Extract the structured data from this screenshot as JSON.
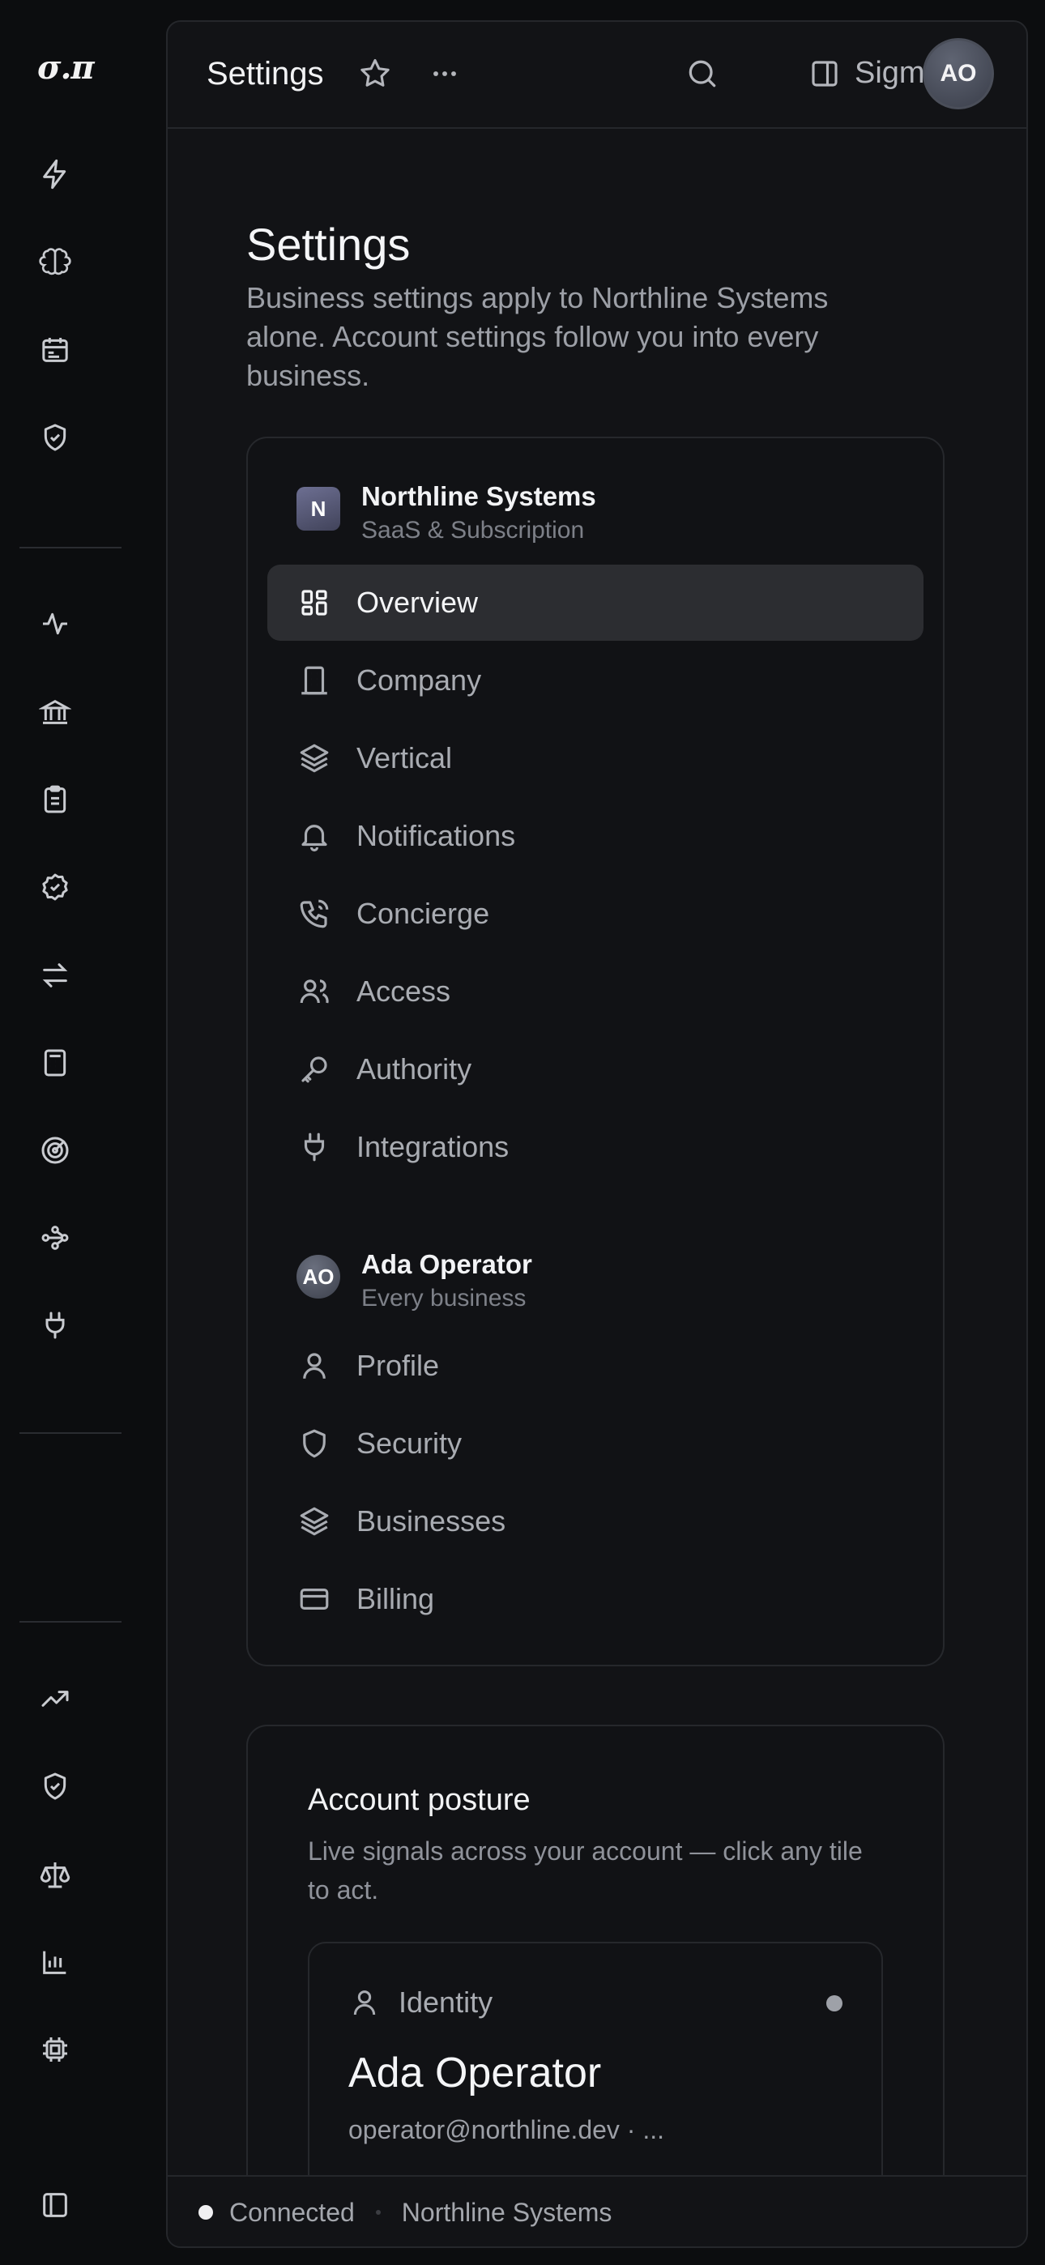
{
  "rail": {
    "logo": "σ.π",
    "icons": [
      "zap-icon",
      "brain-icon",
      "calendar-icon",
      "shield-check-icon",
      "activity-icon",
      "bank-icon",
      "clipboard-list-icon",
      "badge-check-icon",
      "arrows-left-right-icon",
      "calculator-icon",
      "target-icon",
      "workflow-icon",
      "plug-icon",
      "trending-up-icon",
      "shield-check-icon",
      "scale-icon",
      "bar-chart-icon",
      "cpu-icon",
      "panel-icon"
    ]
  },
  "topbar": {
    "title": "Settings",
    "workspace": "Sigma",
    "avatar": "AO"
  },
  "page": {
    "title": "Settings",
    "description": "Business settings apply to Northline Systems alone. Account settings follow you into every business."
  },
  "business": {
    "badge": "N",
    "name": "Northline Systems",
    "subtitle": "SaaS & Subscription",
    "items": [
      {
        "label": "Overview",
        "icon": "dashboard-icon",
        "active": true
      },
      {
        "label": "Company",
        "icon": "building-icon"
      },
      {
        "label": "Vertical",
        "icon": "layers-icon"
      },
      {
        "label": "Notifications",
        "icon": "bell-icon"
      },
      {
        "label": "Concierge",
        "icon": "phone-icon"
      },
      {
        "label": "Access",
        "icon": "users-icon"
      },
      {
        "label": "Authority",
        "icon": "key-icon"
      },
      {
        "label": "Integrations",
        "icon": "plug-icon"
      }
    ]
  },
  "account": {
    "badge": "AO",
    "name": "Ada Operator",
    "subtitle": "Every business",
    "items": [
      {
        "label": "Profile",
        "icon": "user-icon"
      },
      {
        "label": "Security",
        "icon": "shield-icon"
      },
      {
        "label": "Businesses",
        "icon": "layers-icon"
      },
      {
        "label": "Billing",
        "icon": "credit-card-icon"
      }
    ]
  },
  "posture": {
    "title": "Account posture",
    "subtitle": "Live signals across your account — click any tile to act.",
    "tile": {
      "label": "Identity",
      "value": "Ada Operator",
      "detail": "operator@northline.dev · ..."
    }
  },
  "status": {
    "connection": "Connected",
    "business": "Northline Systems"
  }
}
